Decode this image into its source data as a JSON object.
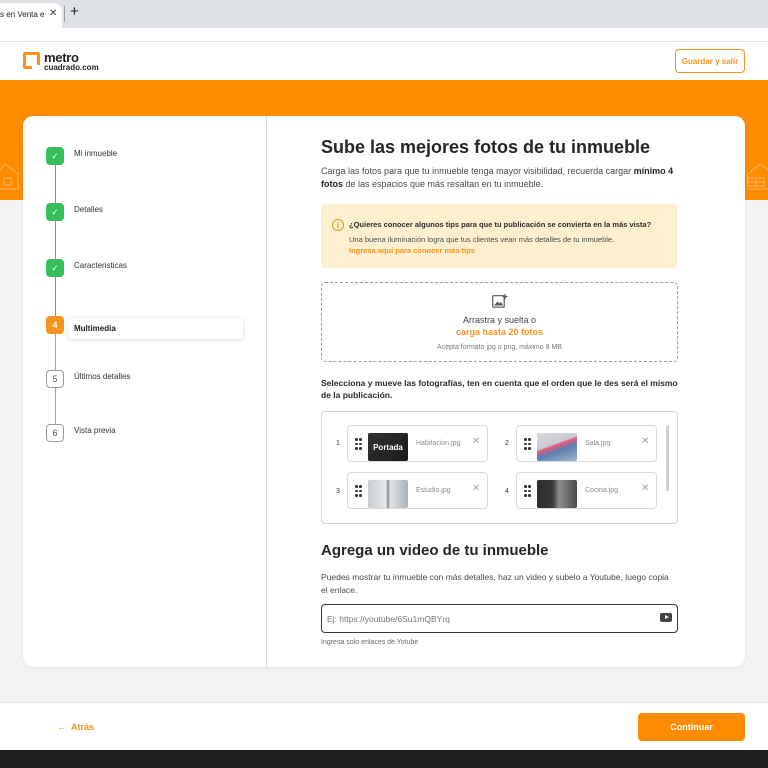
{
  "browser": {
    "tab_title": "s en Venta en",
    "close": "✕",
    "new_tab": "+"
  },
  "header": {
    "logo_line1": "metro",
    "logo_line2": "cuadrado.com",
    "save_exit": "Guardar y salir"
  },
  "stepper": {
    "steps": [
      {
        "marker": "✓",
        "label": "Mi inmueble",
        "state": "done"
      },
      {
        "marker": "✓",
        "label": "Detalles",
        "state": "done"
      },
      {
        "marker": "✓",
        "label": "Caracteristicas",
        "state": "done"
      },
      {
        "marker": "4",
        "label": "Multimedia",
        "state": "active"
      },
      {
        "marker": "5",
        "label": "Últimos detalles",
        "state": "pending"
      },
      {
        "marker": "6",
        "label": "Vista previa",
        "state": "pending"
      }
    ]
  },
  "main": {
    "title": "Sube las mejores fotos de tu inmueble",
    "lead_pre": "Carga las fotos para que tu inmueble tenga mayor visibilidad, recuerda cargar ",
    "lead_bold": "mínimo 4 fotos",
    "lead_post": " de las espacios que más resaltan en tu inmueble.",
    "tip": {
      "icon": "i",
      "title": "¿Quieres conocer algunos tips para que tu publicación se convierta en la más vista?",
      "text": "Una buena iluminación logra que tus clientes vean más detalles de tu inmueble.",
      "link": "Ingresa aquí para conocer más tips"
    },
    "dropzone": {
      "text": "Arrastra y suelta o",
      "link": "carga hasta 20 fotos",
      "hint": "Acepta formato jpg o png, máximo 8 MB"
    },
    "select_title": "Selecciona y mueve las fotografías, ten en cuenta que el orden que le des será el mismo de la publicación.",
    "photos": [
      {
        "num": "1",
        "name": "Habitacion.jpg",
        "cover": "Portada"
      },
      {
        "num": "2",
        "name": "Sala.jpg"
      },
      {
        "num": "3",
        "name": "Estudio.jpg"
      },
      {
        "num": "4",
        "name": "Cocina.jpg"
      }
    ],
    "remove_icon": "✕",
    "video": {
      "title": "Agrega un video de tu inmueble",
      "desc": "Puedes mostrar tu inmueble con más detalles, haz un video y subelo a Youtube, luego copia el enlace.",
      "placeholder": "Ej: https://youtube/6Su1mQBYrq",
      "hint": "Ingresa solo enlaces de Yotube"
    }
  },
  "footer": {
    "back": "Atrás",
    "back_arrow": "←",
    "continue": "Continuar"
  },
  "colors": {
    "brand": "#ff8c00",
    "done": "#37c05a",
    "tip_bg": "#fef0cf"
  }
}
